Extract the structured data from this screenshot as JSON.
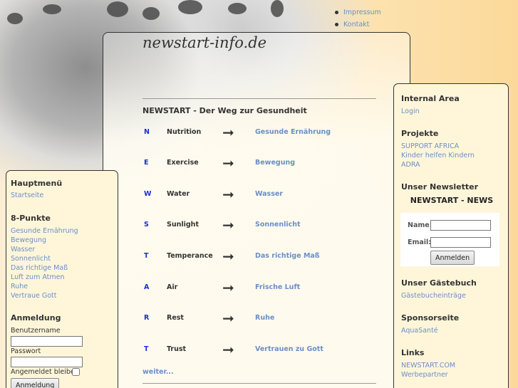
{
  "top_nav": [
    "Impressum",
    "Kontakt"
  ],
  "site_title": "newstart-info.de",
  "content": {
    "heading": "NEWSTART - Der Weg zur Gesundheit",
    "rows": [
      {
        "letter": "N",
        "word": "Nutrition",
        "link": "Gesunde Ernährung"
      },
      {
        "letter": "E",
        "word": "Exercise",
        "link": "Bewegung"
      },
      {
        "letter": "W",
        "word": "Water",
        "link": "Wasser"
      },
      {
        "letter": "S",
        "word": "Sunlight",
        "link": "Sonnenlicht"
      },
      {
        "letter": "T",
        "word": "Temperance",
        "link": "Das richtige Maß"
      },
      {
        "letter": "A",
        "word": "Air",
        "link": "Frische Luft"
      },
      {
        "letter": "R",
        "word": "Rest",
        "link": "Ruhe"
      },
      {
        "letter": "T",
        "word": "Trust",
        "link": "Vertrauen zu Gott"
      }
    ],
    "arrow": "➞",
    "more": "weiter..."
  },
  "left": {
    "main_menu_title": "Hauptmenü",
    "main_menu_items": [
      "Startseite"
    ],
    "points_title": "8-Punkte",
    "points_items": [
      "Gesunde Ernährung",
      "Bewegung",
      "Wasser",
      "Sonnenlicht",
      "Das richtige Maß",
      "Luft zum Atmen",
      "Ruhe",
      "Vertraue Gott"
    ],
    "login_title": "Anmeldung",
    "username_label": "Benutzername",
    "password_label": "Passwort",
    "remember_label": "Angemeldet bleiben",
    "login_button": "Anmeldung"
  },
  "right": {
    "internal_title": "Internal Area",
    "internal_items": [
      "Login"
    ],
    "projects_title": "Projekte",
    "projects_items": [
      "SUPPORT AFRICA",
      "Kinder helfen Kindern",
      "ADRA"
    ],
    "newsletter_title": "Unser Newsletter",
    "newsletter_name": "NEWSTART - NEWS",
    "name_label": "Name:",
    "email_label": "Email:",
    "subscribe_button": "Anmelden",
    "guestbook_title": "Unser Gästebuch",
    "guestbook_items": [
      "Gästebucheinträge"
    ],
    "sponsor_title": "Sponsorseite",
    "sponsor_items": [
      "AquaSanté"
    ],
    "links_title": "Links",
    "links_items": [
      "NEWSTART.COM",
      "Werbepartner"
    ]
  }
}
